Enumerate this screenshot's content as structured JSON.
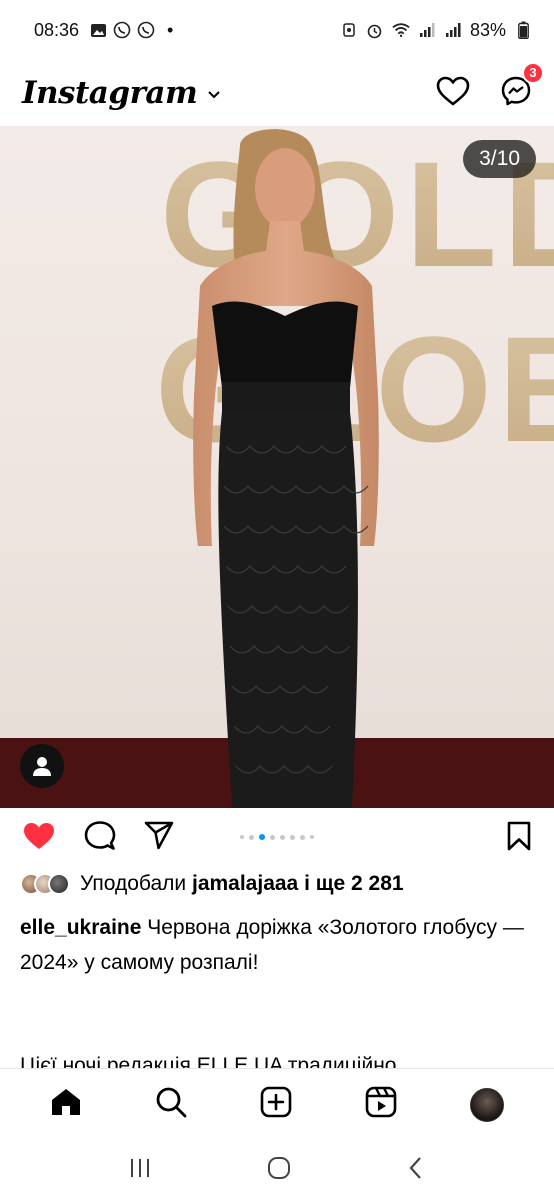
{
  "status_bar": {
    "time": "08:36",
    "dot": "•",
    "battery": "83%"
  },
  "header": {
    "logo": "Instagram",
    "message_badge": "3"
  },
  "post": {
    "image_counter": "3/10",
    "image_description": "Woman in black strapless gown on Golden Globes red carpet",
    "backdrop_letters": [
      "GOLDE",
      "GLOBE"
    ],
    "carousel_total": 10,
    "carousel_active": 3,
    "liked": true,
    "likes_text": "Уподобали",
    "likes_user": "jamalajaaa",
    "likes_rest": "і ще 2 281",
    "caption_user": "elle_ukraine",
    "caption_text": "Червона доріжка «Золотого глобусу — 2024» у самому розпалі!",
    "caption_next": "Цієї ночі редакція ELLE UA традиційно"
  },
  "colors": {
    "like_red": "#ff3040",
    "active_dot": "#0095f6"
  },
  "icons": {
    "header": [
      "heart-icon",
      "messenger-icon"
    ],
    "actions": [
      "heart-filled-icon",
      "comment-icon",
      "share-icon",
      "bookmark-icon"
    ],
    "nav": [
      "home-icon",
      "search-icon",
      "create-icon",
      "reels-icon",
      "profile-avatar"
    ]
  }
}
